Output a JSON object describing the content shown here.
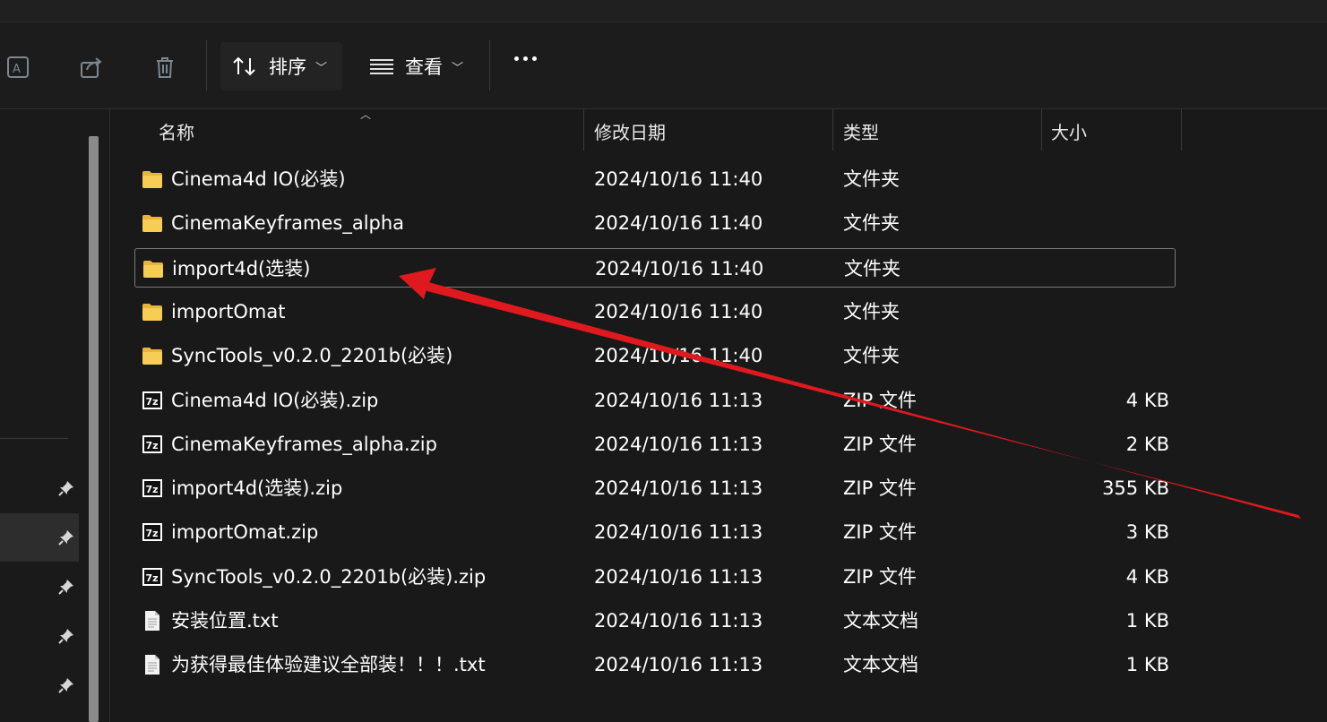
{
  "toolbar": {
    "sort_label": "排序",
    "view_label": "查看",
    "icons": [
      "translate-icon",
      "share-icon",
      "delete-icon",
      "sort-icon",
      "view-icon",
      "more-icon"
    ]
  },
  "columns": {
    "name": "名称",
    "date": "修改日期",
    "type": "类型",
    "size": "大小"
  },
  "files": [
    {
      "name": "Cinema4d IO(必装)",
      "date": "2024/10/16 11:40",
      "type": "文件夹",
      "size": "",
      "kind": "folder"
    },
    {
      "name": "CinemaKeyframes_alpha",
      "date": "2024/10/16 11:40",
      "type": "文件夹",
      "size": "",
      "kind": "folder"
    },
    {
      "name": "import4d(选装)",
      "date": "2024/10/16 11:40",
      "type": "文件夹",
      "size": "",
      "kind": "folder"
    },
    {
      "name": "importOmat",
      "date": "2024/10/16 11:40",
      "type": "文件夹",
      "size": "",
      "kind": "folder"
    },
    {
      "name": "SyncTools_v0.2.0_2201b(必装)",
      "date": "2024/10/16 11:40",
      "type": "文件夹",
      "size": "",
      "kind": "folder"
    },
    {
      "name": "Cinema4d IO(必装).zip",
      "date": "2024/10/16 11:13",
      "type": "ZIP 文件",
      "size": "4 KB",
      "kind": "zip"
    },
    {
      "name": "CinemaKeyframes_alpha.zip",
      "date": "2024/10/16 11:13",
      "type": "ZIP 文件",
      "size": "2 KB",
      "kind": "zip"
    },
    {
      "name": "import4d(选装).zip",
      "date": "2024/10/16 11:13",
      "type": "ZIP 文件",
      "size": "355 KB",
      "kind": "zip"
    },
    {
      "name": "importOmat.zip",
      "date": "2024/10/16 11:13",
      "type": "ZIP 文件",
      "size": "3 KB",
      "kind": "zip"
    },
    {
      "name": "SyncTools_v0.2.0_2201b(必装).zip",
      "date": "2024/10/16 11:13",
      "type": "ZIP 文件",
      "size": "4 KB",
      "kind": "zip"
    },
    {
      "name": "安装位置.txt",
      "date": "2024/10/16 11:13",
      "type": "文本文档",
      "size": "1 KB",
      "kind": "txt"
    },
    {
      "name": "为获得最佳体验建议全部装！！！.txt",
      "date": "2024/10/16 11:13",
      "type": "文本文档",
      "size": "1 KB",
      "kind": "txt"
    }
  ],
  "zip_icon_text": "7z",
  "focused_row": 2,
  "annotation": {
    "shape": "red-arrow",
    "color": "#e0191f"
  },
  "colors": {
    "background": "#191919",
    "folder": "#f6c445",
    "text": "#ffffff",
    "arrow": "#e0191f"
  }
}
